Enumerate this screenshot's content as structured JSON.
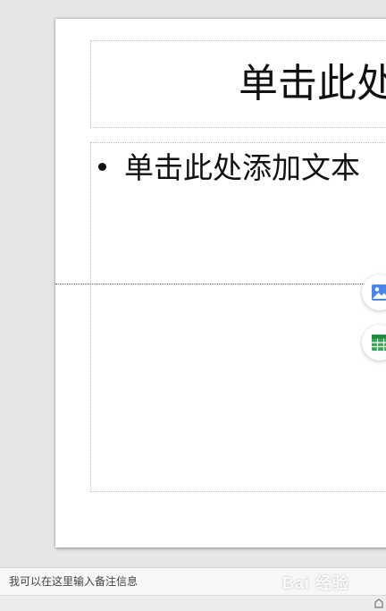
{
  "slide": {
    "title_placeholder": "单击此处",
    "body_placeholder": "单击此处添加文本"
  },
  "content_tools": [
    {
      "name": "insert-picture",
      "icon": "picture-icon",
      "color": "#4a86e8"
    },
    {
      "name": "insert-table",
      "icon": "table-icon",
      "color": "#34a853"
    }
  ],
  "notes": {
    "placeholder": "我可以在这里输入备注信息"
  },
  "watermark": {
    "text": "Bai 经验"
  }
}
